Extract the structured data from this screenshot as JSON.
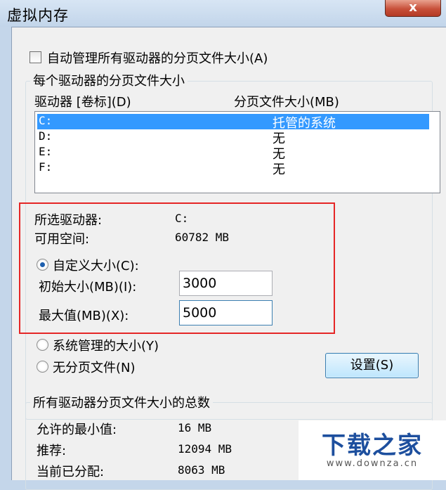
{
  "window": {
    "title": "虚拟内存",
    "close_label": "x"
  },
  "auto_manage": {
    "label": "自动管理所有驱动器的分页文件大小(A)",
    "checked": false
  },
  "per_drive_group": {
    "title": "每个驱动器的分页文件大小",
    "col_drive": "驱动器 [卷标](D)",
    "col_size": "分页文件大小(MB)",
    "rows": [
      {
        "drive": "C:",
        "size": "托管的系统",
        "selected": true
      },
      {
        "drive": "D:",
        "size": "无",
        "selected": false
      },
      {
        "drive": "E:",
        "size": "无",
        "selected": false
      },
      {
        "drive": "F:",
        "size": "无",
        "selected": false
      }
    ]
  },
  "selected_info": {
    "drive_label": "所选驱动器:",
    "drive_value": "C:",
    "space_label": "可用空间:",
    "space_value": "60782 MB"
  },
  "options": {
    "custom_label": "自定义大小(C):",
    "initial_label": "初始大小(MB)(I):",
    "initial_value": "3000",
    "max_label": "最大值(MB)(X):",
    "max_value": "5000",
    "system_label": "系统管理的大小(Y)",
    "none_label": "无分页文件(N)",
    "set_button": "设置(S)"
  },
  "totals_group": {
    "title": "所有驱动器分页文件大小的总数",
    "min_label": "允许的最小值:",
    "min_value": "16 MB",
    "rec_label": "推荐:",
    "rec_value": "12094 MB",
    "cur_label": "当前已分配:",
    "cur_value": "8063 MB"
  },
  "watermark": {
    "title": "下载之家",
    "url": "www.downza.cn"
  },
  "colors": {
    "accent": "#3399ff",
    "highlight_box": "#e52626",
    "watermark": "#1d4f9e"
  }
}
